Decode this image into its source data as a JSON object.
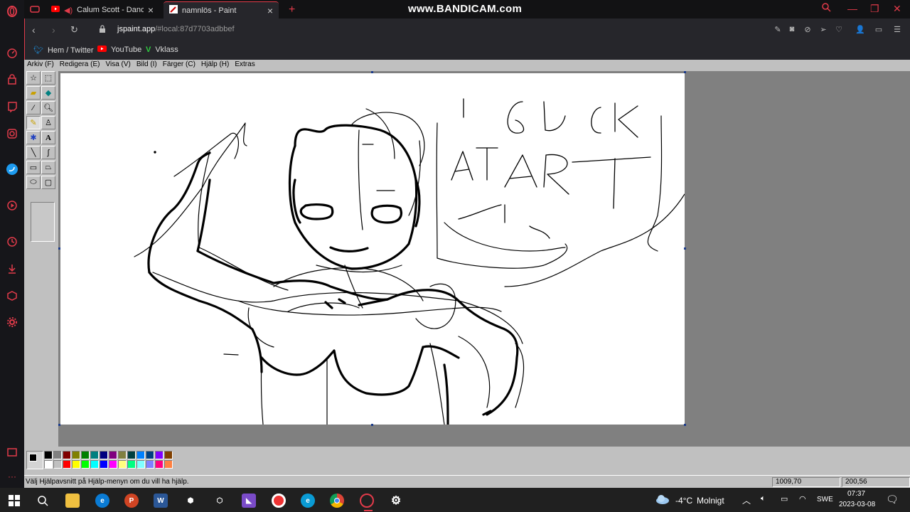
{
  "browser": {
    "watermark": "www.BANDICAM.com",
    "tabs": [
      {
        "title": "Calum Scott - Dancing",
        "active": false
      },
      {
        "title": "namnlös - Paint",
        "active": true
      }
    ],
    "url_domain": "jspaint.app",
    "url_path": "/#local:87d7703adbbef",
    "bookmarks": [
      {
        "label": "Hem / Twitter",
        "icon": "twitter-icon"
      },
      {
        "label": "YouTube",
        "icon": "youtube-icon"
      },
      {
        "label": "Vklass",
        "icon": "vklass-icon"
      }
    ]
  },
  "paint": {
    "menu": [
      "Arkiv (F)",
      "Redigera (E)",
      "Visa (V)",
      "Bild (I)",
      "Färger (C)",
      "Hjälp (H)",
      "Extras"
    ],
    "tools": [
      "free-form-select",
      "select",
      "eraser",
      "fill",
      "color-picker",
      "magnifier",
      "pencil",
      "brush",
      "airbrush",
      "text",
      "line",
      "curve",
      "rectangle",
      "polygon",
      "ellipse",
      "rounded-rectangle"
    ],
    "selected_tool": "pencil",
    "drawing_text": "I SUCK AT ART",
    "palette_top": [
      "#000000",
      "#808080",
      "#800000",
      "#808000",
      "#008000",
      "#008080",
      "#000080",
      "#800080",
      "#808040",
      "#004040",
      "#0080ff",
      "#004080",
      "#8000ff",
      "#804000"
    ],
    "palette_bottom": [
      "#ffffff",
      "#c0c0c0",
      "#ff0000",
      "#ffff00",
      "#00ff00",
      "#00ffff",
      "#0000ff",
      "#ff00ff",
      "#ffff80",
      "#00ff80",
      "#80ffff",
      "#8080ff",
      "#ff0080",
      "#ff8040"
    ],
    "status_help": "Välj Hjälpavsnitt på Hjälp-menyn om du vill ha hjälp.",
    "status_coords": "1009,70",
    "status_size": "200,56"
  },
  "taskbar": {
    "weather_temp": "-4°C",
    "weather_text": "Molnigt",
    "language": "SWE",
    "time": "07:37",
    "date": "2023-03-08"
  },
  "colors": {
    "opera_red": "#e23b4a",
    "taskbar": "#202020"
  }
}
